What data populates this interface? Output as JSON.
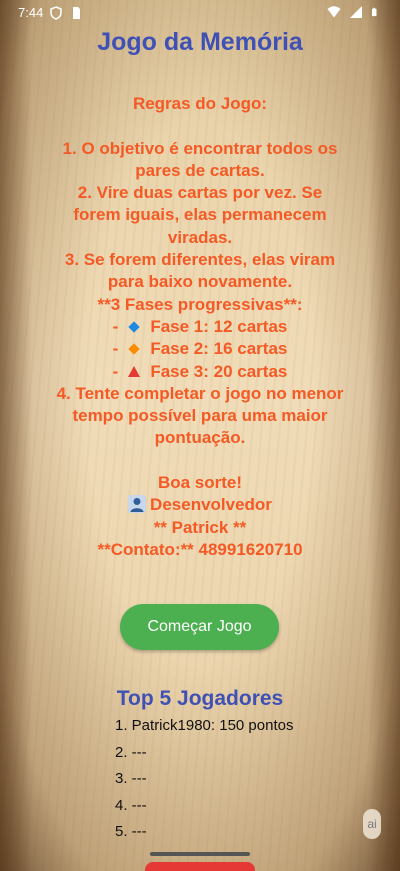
{
  "status": {
    "time": "7:44",
    "left_icons": [
      "shield-icon",
      "sim-card-icon"
    ],
    "right_icons": [
      "wifi-icon",
      "signal-icon",
      "battery-icon"
    ]
  },
  "app": {
    "title": "Jogo da Memória"
  },
  "rules": {
    "heading": "Regras do Jogo:",
    "r1_a": "1. O objetivo é encontrar todos os",
    "r1_b": "pares de cartas.",
    "r2_a": "2. Vire duas cartas por vez. Se",
    "r2_b": "forem iguais, elas permanecem",
    "r2_c": "viradas.",
    "r3_a": "3. Se forem diferentes, elas viram",
    "r3_b": "para baixo novamente.",
    "phases_heading": "**3 Fases progressivas**:",
    "phases": [
      {
        "prefix": "-",
        "icon": "blue-diamond-icon",
        "label": "Fase 1: 12 cartas",
        "color": "#1e88e5"
      },
      {
        "prefix": "-",
        "icon": "orange-diamond-icon",
        "label": "Fase 2: 16 cartas",
        "color": "#fb8c00"
      },
      {
        "prefix": "-",
        "icon": "red-triangle-icon",
        "label": "Fase 3: 20 cartas",
        "color": "#e53935"
      }
    ],
    "r4_a": "4. Tente completar o jogo no menor",
    "r4_b": "tempo possível para uma maior",
    "r4_c": "pontuação.",
    "good_luck": "Boa sorte!",
    "developer": "Desenvolvedor",
    "developer_name": "** Patrick **",
    "contact": "**Contato:** 48991620710"
  },
  "actions": {
    "start_label": "Começar Jogo"
  },
  "leaderboard": {
    "title": "Top 5 Jogadores",
    "entries": [
      "1. Patrick1980: 150 pontos",
      "2. ---",
      "3. ---",
      "4. ---",
      "5. ---"
    ]
  },
  "assistant": {
    "label": "ai"
  },
  "colors": {
    "title": "#3f51b5",
    "rules_text": "#f45a25",
    "button": "#4caf50"
  }
}
